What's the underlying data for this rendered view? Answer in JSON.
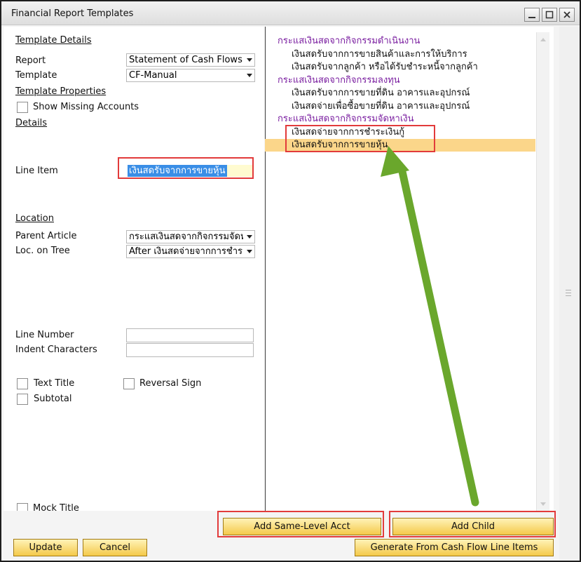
{
  "window": {
    "title": "Financial Report Templates",
    "controls": [
      "minimize",
      "maximize",
      "close"
    ]
  },
  "left": {
    "section_template_details": "Template Details",
    "report_label": "Report",
    "report_value": "Statement of Cash Flows",
    "template_label": "Template",
    "template_value": "CF-Manual",
    "section_template_properties": "Template Properties",
    "show_missing_accounts": "Show Missing Accounts",
    "section_details": "Details",
    "line_item_label": "Line Item",
    "line_item_value": "เงินสดรับจากการขายหุ้น",
    "section_location": "Location",
    "parent_article_label": "Parent Article",
    "parent_article_value": "กระแสเงินสดจากกิจกรรมจัดหา",
    "loc_on_tree_label": "Loc. on Tree",
    "loc_on_tree_value": "After เงินสดจ่ายจากการชำระเ",
    "line_number_label": "Line Number",
    "indent_characters_label": "Indent Characters",
    "text_title_label": "Text Title",
    "reversal_sign_label": "Reversal Sign",
    "subtotal_label": "Subtotal",
    "mock_title_label": "Mock Title"
  },
  "tree": [
    {
      "text": "กระแสเงินสดจากกิจกรรมดำเนินงาน",
      "level": 0
    },
    {
      "text": "เงินสดรับจากการขายสินค้าและการให้บริการ",
      "level": 1
    },
    {
      "text": "เงินสดรับจากลูกค้า หรือได้รับชำระหนี้จากลูกค้า",
      "level": 1
    },
    {
      "text": "กระแสเงินสดจากกิจกรรมลงทุน",
      "level": 0
    },
    {
      "text": "เงินสดรับจากการขายที่ดิน อาคารและอุปกรณ์",
      "level": 1
    },
    {
      "text": "เงินสดจ่ายเพื่อซื้อขายที่ดิน อาคารและอุปกรณ์",
      "level": 1
    },
    {
      "text": "กระแสเงินสดจากกิจกรรมจัดหาเงิน",
      "level": 0
    },
    {
      "text": "เงินสดจ่ายจากการชำระเงินกู้",
      "level": 1
    },
    {
      "text": "เงินสดรับจากการขายหุ้น",
      "level": 1,
      "selected": true
    }
  ],
  "buttons": {
    "add_same_level": "Add Same-Level Acct",
    "add_child": "Add Child",
    "update": "Update",
    "cancel": "Cancel",
    "generate": "Generate From Cash Flow Line Items"
  },
  "colors": {
    "tree_heading": "#7a1ea0",
    "selection": "#fbd68a",
    "highlight_box": "#e23b3b",
    "arrow": "#6aa72c",
    "button_gold": "#f4c94a"
  }
}
